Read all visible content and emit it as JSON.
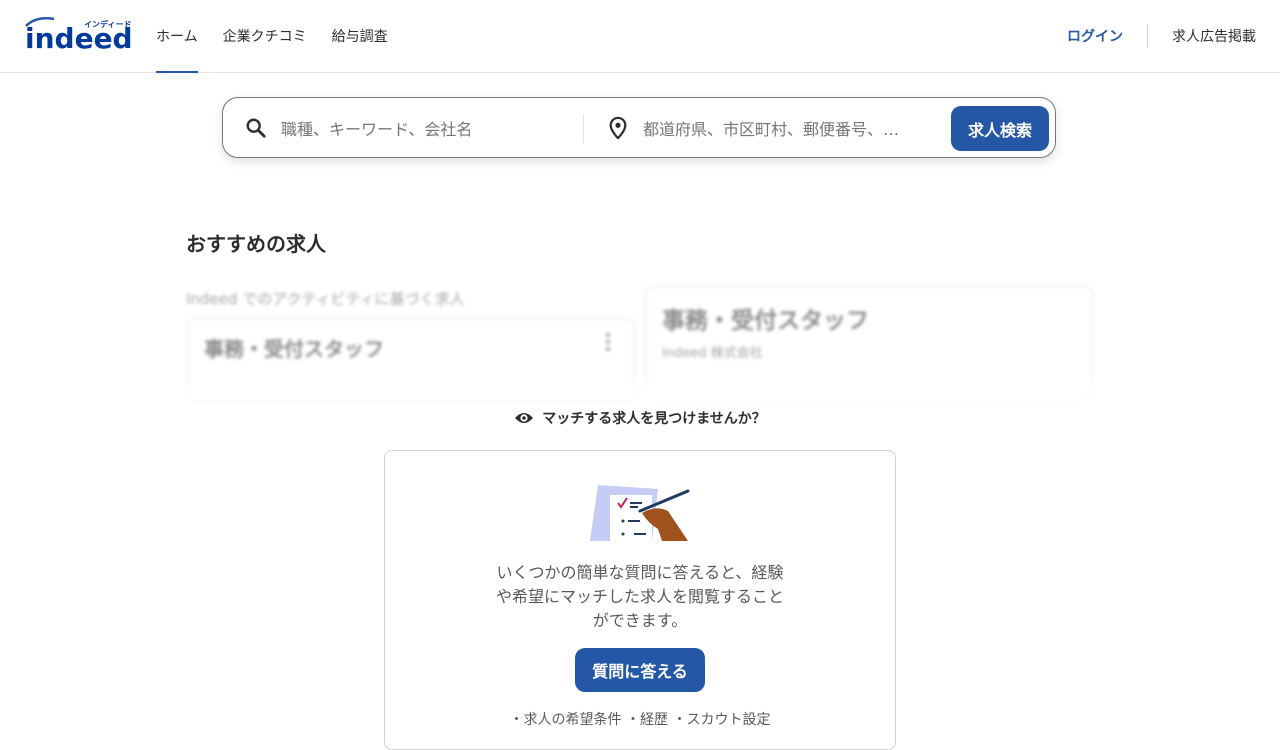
{
  "header": {
    "logo_text": "indeed",
    "logo_katakana": "インディード",
    "nav": [
      "ホーム",
      "企業クチコミ",
      "給与調査"
    ],
    "active_nav": "ホーム",
    "login": "ログイン",
    "post_jobs": "求人広告掲載"
  },
  "search": {
    "what_placeholder": "職種、キーワード、会社名",
    "where_placeholder": "都道府県、市区町村、郵便番号、…",
    "button": "求人検索"
  },
  "recommended": {
    "title": "おすすめの求人",
    "subtitle": "Indeed でのアクティビティに基づく求人",
    "cards": [
      {
        "title": "事務・受付スタッフ",
        "company": ""
      },
      {
        "title": "事務・受付スタッフ",
        "company": "Indeed 株式会社"
      }
    ]
  },
  "prompt": {
    "heading": "マッチする求人を見つけませんか？",
    "description": "いくつかの簡単な質問に答えると、経験や希望にマッチした求人を閲覧することができます。",
    "button": "質問に答える",
    "bullets": "・求人の希望条件 ・経歴 ・スカウト設定"
  },
  "colors": {
    "brand_blue": "#2557a7",
    "text": "#2d2d2d",
    "muted": "#595959",
    "border": "#d4d2d0"
  },
  "icons": [
    "search-icon",
    "location-pin-icon",
    "eye-icon",
    "kebab-menu-icon"
  ]
}
